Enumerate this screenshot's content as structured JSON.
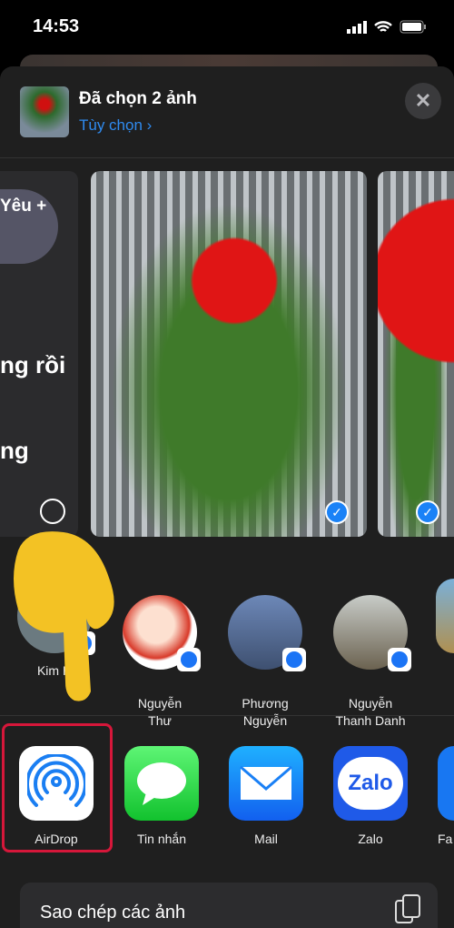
{
  "status_bar": {
    "time": "14:53"
  },
  "header": {
    "title": "Đã chọn 2 ảnh",
    "options_link": "Tùy chọn ›",
    "close_icon": "close-icon"
  },
  "left_card": {
    "lines": [
      "Yêu +",
      "ng rồi",
      "ng"
    ]
  },
  "contacts": [
    {
      "name": "Kim H",
      "badge": "messenger-icon"
    },
    {
      "name": "Nguyễn\nThư",
      "badge": "messenger-icon"
    },
    {
      "name": "Phương\nNguyễn",
      "badge": "messenger-icon"
    },
    {
      "name": "Nguyễn\nThanh Danh",
      "badge": "messenger-icon"
    }
  ],
  "apps": [
    {
      "name": "AirDrop",
      "color": "#ffffff"
    },
    {
      "name": "Tin nhắn",
      "color": "#2fd34a"
    },
    {
      "name": "Mail",
      "color": "#1a8cf7"
    },
    {
      "name": "Zalo",
      "color": "#1f5ae8",
      "logo_text": "Zalo"
    },
    {
      "name": "Fa",
      "color": "#1877f2"
    }
  ],
  "actions": [
    {
      "label": "Sao chép các ảnh",
      "icon": "copy-icon"
    }
  ],
  "highlight_color": "#d6173a"
}
